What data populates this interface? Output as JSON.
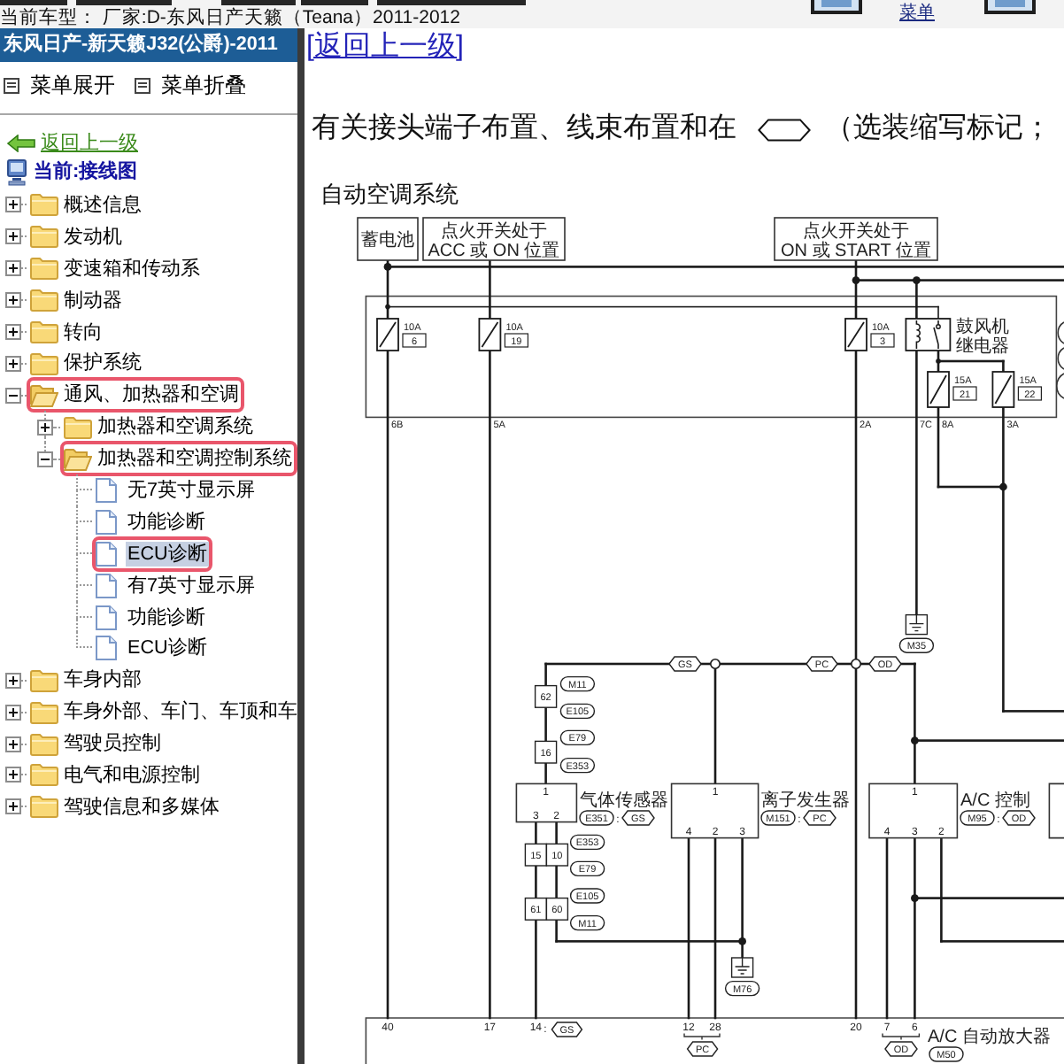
{
  "top_bar": {
    "car_model": "当前车型： 厂家:D-东风日产天籁（Teana）2011-2012",
    "menu_link": "菜单"
  },
  "sidebar": {
    "title": "东风日产-新天籁J32(公爵)-2011",
    "menu_actions": [
      "菜单展开",
      "菜单折叠"
    ],
    "back_link": "返回上一级",
    "current": "当前:接线图",
    "tree": [
      {
        "label": "概述信息",
        "kind": "folder",
        "expanded": false,
        "selected": false,
        "highlighted": false
      },
      {
        "label": "发动机",
        "kind": "folder",
        "expanded": false,
        "selected": false,
        "highlighted": false
      },
      {
        "label": "变速箱和传动系",
        "kind": "folder",
        "expanded": false,
        "selected": false,
        "highlighted": false
      },
      {
        "label": "制动器",
        "kind": "folder",
        "expanded": false,
        "selected": false,
        "highlighted": false
      },
      {
        "label": "转向",
        "kind": "folder",
        "expanded": false,
        "selected": false,
        "highlighted": false
      },
      {
        "label": "保护系统",
        "kind": "folder",
        "expanded": false,
        "selected": false,
        "highlighted": false
      },
      {
        "label": "通风、加热器和空调",
        "kind": "folder",
        "expanded": true,
        "selected": false,
        "highlighted": true,
        "children": [
          {
            "label": "加热器和空调系统",
            "kind": "folder",
            "expanded": false,
            "selected": false,
            "highlighted": false
          },
          {
            "label": "加热器和空调控制系统",
            "kind": "folder",
            "expanded": true,
            "selected": false,
            "highlighted": true,
            "children": [
              {
                "label": "无7英寸显示屏",
                "kind": "page",
                "selected": false,
                "highlighted": false
              },
              {
                "label": "功能诊断",
                "kind": "page",
                "selected": false,
                "highlighted": false
              },
              {
                "label": "ECU诊断",
                "kind": "page",
                "selected": true,
                "highlighted": true
              },
              {
                "label": "有7英寸显示屏",
                "kind": "page",
                "selected": false,
                "highlighted": false
              },
              {
                "label": "功能诊断",
                "kind": "page",
                "selected": false,
                "highlighted": false
              },
              {
                "label": "ECU诊断",
                "kind": "page",
                "selected": false,
                "highlighted": false
              }
            ]
          }
        ]
      },
      {
        "label": "车身内部",
        "kind": "folder",
        "expanded": false,
        "selected": false,
        "highlighted": false
      },
      {
        "label": "车身外部、车门、车顶和车",
        "kind": "folder",
        "expanded": false,
        "selected": false,
        "highlighted": false
      },
      {
        "label": "驾驶员控制",
        "kind": "folder",
        "expanded": false,
        "selected": false,
        "highlighted": false
      },
      {
        "label": "电气和电源控制",
        "kind": "folder",
        "expanded": false,
        "selected": false,
        "highlighted": false
      },
      {
        "label": "驾驶信息和多媒体",
        "kind": "folder",
        "expanded": false,
        "selected": false,
        "highlighted": false
      }
    ]
  },
  "content": {
    "back_link": "[返回上一级]",
    "note_before": "有关接头端子布置、线束布置和在",
    "note_after": "（选装缩写标记；",
    "diagram": {
      "title": "自动空调系统",
      "sources": [
        {
          "lines": [
            "蓄电池"
          ]
        },
        {
          "lines": [
            "点火开关处于",
            "ACC 或 ON 位置"
          ]
        },
        {
          "lines": [
            "点火开关处于",
            "ON 或 START 位置"
          ]
        }
      ],
      "fuses": [
        {
          "rating": "10A",
          "number": "6"
        },
        {
          "rating": "10A",
          "number": "19"
        },
        {
          "rating": "10A",
          "number": "3"
        },
        {
          "rating": "15A",
          "number": "21"
        },
        {
          "rating": "15A",
          "number": "22"
        }
      ],
      "relay": {
        "lines": [
          "鼓风机",
          "继电器"
        ]
      },
      "fuse_block_terminals": [
        "6B",
        "5A",
        "2A",
        "7C",
        "8A",
        "3A"
      ],
      "grounds": [
        {
          "connector": "M35"
        },
        {
          "connector": "M76"
        }
      ],
      "line_tags": [
        "GS",
        "PC",
        "OD"
      ],
      "splices": [
        {
          "pins": [
            "62"
          ],
          "upper": "M11",
          "lower": "E105"
        },
        {
          "pins": [
            "16"
          ],
          "upper": "E79",
          "lower": "E353"
        },
        {
          "pins": [
            "15",
            "10"
          ],
          "upper": "E353",
          "lower": "E79"
        },
        {
          "pins": [
            "61",
            "60"
          ],
          "upper": "E105",
          "lower": "M11"
        }
      ],
      "components": [
        {
          "name": "气体传感器",
          "connector": "E351",
          "separator": ":",
          "tag": "GS",
          "top_pin": "1",
          "bottom_pins": [
            "3",
            "2"
          ]
        },
        {
          "name": "离子发生器",
          "connector": "M151",
          "separator": ":",
          "tag": "PC",
          "top_pin": "1",
          "bottom_pins": [
            "4",
            "2",
            "3"
          ]
        },
        {
          "name": "A/C 控制",
          "connector": "M95",
          "separator": ":",
          "tag": "OD",
          "top_pin": "1",
          "bottom_pins": [
            "4",
            "3",
            "2"
          ]
        }
      ],
      "amplifier": {
        "name": "A/C 自动放大器",
        "connector": "M50",
        "terminals": [
          "40",
          "17",
          "14",
          "12",
          "28",
          "20",
          "7",
          "6"
        ],
        "terminal_tags": [
          {
            "separator": ":",
            "tag": "GS"
          },
          {
            "tag": "PC"
          },
          {
            "tag": "OD"
          }
        ]
      }
    }
  }
}
